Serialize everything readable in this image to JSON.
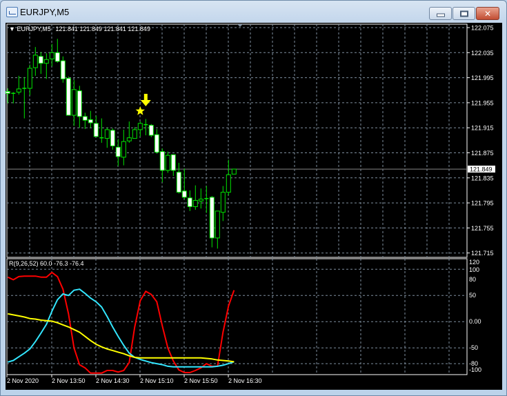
{
  "window": {
    "title": "EURJPY,M5",
    "icon": "chart-window-icon",
    "buttons": [
      "minimize-icon",
      "maximize-icon",
      "close-icon"
    ]
  },
  "chart": {
    "symbol_label": "EURJPY,M5",
    "ohlc_label": "121.841 121.849 121.841 121.849",
    "bid_price": 121.849,
    "bid_label": "121.849",
    "price_ticks": [
      "122.075",
      "122.035",
      "121.995",
      "121.955",
      "121.915",
      "121.875",
      "121.835",
      "121.795",
      "121.755",
      "121.715"
    ],
    "colors": {
      "background": "#000000",
      "bull_outline": "#00e600",
      "bear_body": "#ffffff",
      "grid": "#8090a0",
      "signal": "#ffff00"
    },
    "signal": {
      "type": "sell-arrow",
      "arrow_icon": "down-arrow-icon",
      "star_icon": "star-icon",
      "arrow_bar": 25,
      "star_bar": 24
    },
    "candles": [
      [
        121.973,
        121.978,
        121.954,
        121.97
      ],
      [
        121.97,
        121.972,
        121.954,
        121.97
      ],
      [
        121.972,
        121.998,
        121.968,
        121.977
      ],
      [
        121.978,
        121.996,
        121.93,
        121.978
      ],
      [
        121.978,
        122.016,
        121.967,
        122.01
      ],
      [
        122.011,
        122.044,
        121.998,
        122.031
      ],
      [
        122.029,
        122.036,
        122.001,
        122.018
      ],
      [
        122.018,
        122.034,
        121.993,
        122.024
      ],
      [
        122.025,
        122.049,
        122.013,
        122.035
      ],
      [
        122.035,
        122.057,
        122.019,
        122.021
      ],
      [
        122.022,
        122.029,
        121.987,
        121.993
      ],
      [
        121.994,
        121.997,
        121.935,
        121.935
      ],
      [
        121.935,
        121.991,
        121.918,
        121.976
      ],
      [
        121.974,
        121.982,
        121.915,
        121.933
      ],
      [
        121.933,
        121.939,
        121.913,
        121.927
      ],
      [
        121.928,
        121.942,
        121.915,
        121.923
      ],
      [
        121.922,
        121.934,
        121.9,
        121.901
      ],
      [
        121.899,
        121.93,
        121.891,
        121.899
      ],
      [
        121.898,
        121.915,
        121.883,
        121.912
      ],
      [
        121.911,
        121.914,
        121.88,
        121.886
      ],
      [
        121.884,
        121.897,
        121.854,
        121.869
      ],
      [
        121.868,
        121.912,
        121.855,
        121.893
      ],
      [
        121.894,
        121.925,
        121.891,
        121.899
      ],
      [
        121.898,
        121.916,
        121.898,
        121.912
      ],
      [
        121.912,
        121.925,
        121.901,
        121.922
      ],
      [
        121.92,
        121.929,
        121.903,
        121.92
      ],
      [
        121.919,
        121.921,
        121.9,
        121.903
      ],
      [
        121.904,
        121.913,
        121.874,
        121.876
      ],
      [
        121.877,
        121.882,
        121.828,
        121.847
      ],
      [
        121.847,
        121.877,
        121.843,
        121.871
      ],
      [
        121.872,
        121.872,
        121.838,
        121.847
      ],
      [
        121.844,
        121.859,
        121.81,
        121.812
      ],
      [
        121.814,
        121.85,
        121.801,
        121.804
      ],
      [
        121.803,
        121.815,
        121.782,
        121.789
      ],
      [
        121.789,
        121.823,
        121.784,
        121.799
      ],
      [
        121.798,
        121.818,
        121.786,
        121.801
      ],
      [
        121.802,
        121.822,
        121.779,
        121.802
      ],
      [
        121.804,
        121.806,
        121.724,
        121.739
      ],
      [
        121.739,
        121.782,
        121.722,
        121.782
      ],
      [
        121.78,
        121.822,
        121.766,
        121.812
      ],
      [
        121.812,
        121.864,
        121.807,
        121.84
      ],
      [
        121.841,
        121.849,
        121.841,
        121.849
      ]
    ]
  },
  "indicator": {
    "label": "R(9,26,52) 60.0 -76.3 -76.4",
    "ticks": [
      "120",
      "100",
      "80",
      "50",
      "0.00",
      "-50",
      "-80",
      "-100"
    ],
    "range": [
      -100,
      120
    ],
    "levels": [
      100,
      50,
      0,
      -50,
      -80
    ],
    "series": [
      {
        "color": "#ff0000",
        "values": [
          85,
          80,
          86,
          87,
          87,
          87,
          85,
          85,
          94,
          86,
          62,
          15,
          -50,
          -82,
          -88,
          -98,
          -98,
          -98,
          -93,
          -93,
          -96,
          -93,
          -78,
          -10,
          40,
          58,
          52,
          38,
          -8,
          -50,
          -75,
          -92,
          -97,
          -97,
          -93,
          -88,
          -80,
          -85,
          -85,
          -20,
          30,
          60.0
        ]
      },
      {
        "color": "#33e6ff",
        "values": [
          -77,
          -74,
          -67,
          -60,
          -52,
          -38,
          -22,
          -5,
          20,
          42,
          53,
          50,
          60,
          62,
          54,
          45,
          38,
          28,
          10,
          -10,
          -28,
          -45,
          -60,
          -68,
          -72,
          -75,
          -78,
          -80,
          -82,
          -85,
          -86,
          -86,
          -86,
          -86,
          -86,
          -86,
          -86,
          -86,
          -85,
          -83,
          -80,
          -76.3
        ]
      },
      {
        "color": "#ffff00",
        "values": [
          15,
          13,
          11,
          9,
          6,
          5,
          3,
          2,
          1,
          -2,
          -6,
          -10,
          -15,
          -20,
          -28,
          -36,
          -43,
          -48,
          -52,
          -55,
          -58,
          -61,
          -65,
          -68,
          -69,
          -69,
          -69,
          -69,
          -69,
          -69,
          -69,
          -69,
          -69,
          -69,
          -69,
          -69,
          -70,
          -71,
          -73,
          -74,
          -75,
          -76.4
        ]
      }
    ]
  },
  "time_axis": [
    "2 Nov 2020",
    "2 Nov 13:50",
    "2 Nov 14:30",
    "2 Nov 15:10",
    "2 Nov 15:50",
    "2 Nov 16:30"
  ]
}
